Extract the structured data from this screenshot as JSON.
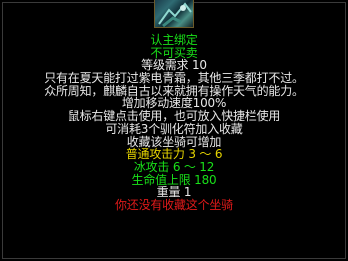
{
  "item": {
    "icon": "mount-item-icon",
    "lines": [
      {
        "text": "认主绑定",
        "color": "green"
      },
      {
        "text": "不可买卖",
        "color": "green"
      },
      {
        "text": "等级需求   10",
        "color": "white"
      },
      {
        "text": "只有在夏天能打过紫电青霜，其他三季都打不过。",
        "color": "white"
      },
      {
        "text": "众所周知，麒麟自古以来就拥有操作天气的能力。",
        "color": "white"
      },
      {
        "text": "增加移动速度100%",
        "color": "white"
      },
      {
        "text": "鼠标右键点击使用，也可放入快捷栏使用",
        "color": "white"
      },
      {
        "text": "可消耗3个驯化符加入收藏",
        "color": "white"
      },
      {
        "text": "收藏该坐骑可增加",
        "color": "white"
      },
      {
        "text": "普通攻击力 3 ～ 6",
        "color": "yellow"
      },
      {
        "text": "冰攻击 6 ～ 12",
        "color": "green"
      },
      {
        "text": "生命值上限 180",
        "color": "green"
      },
      {
        "text": "重量   1",
        "color": "white"
      },
      {
        "text": "你还没有收藏这个坐骑",
        "color": "red"
      }
    ]
  }
}
